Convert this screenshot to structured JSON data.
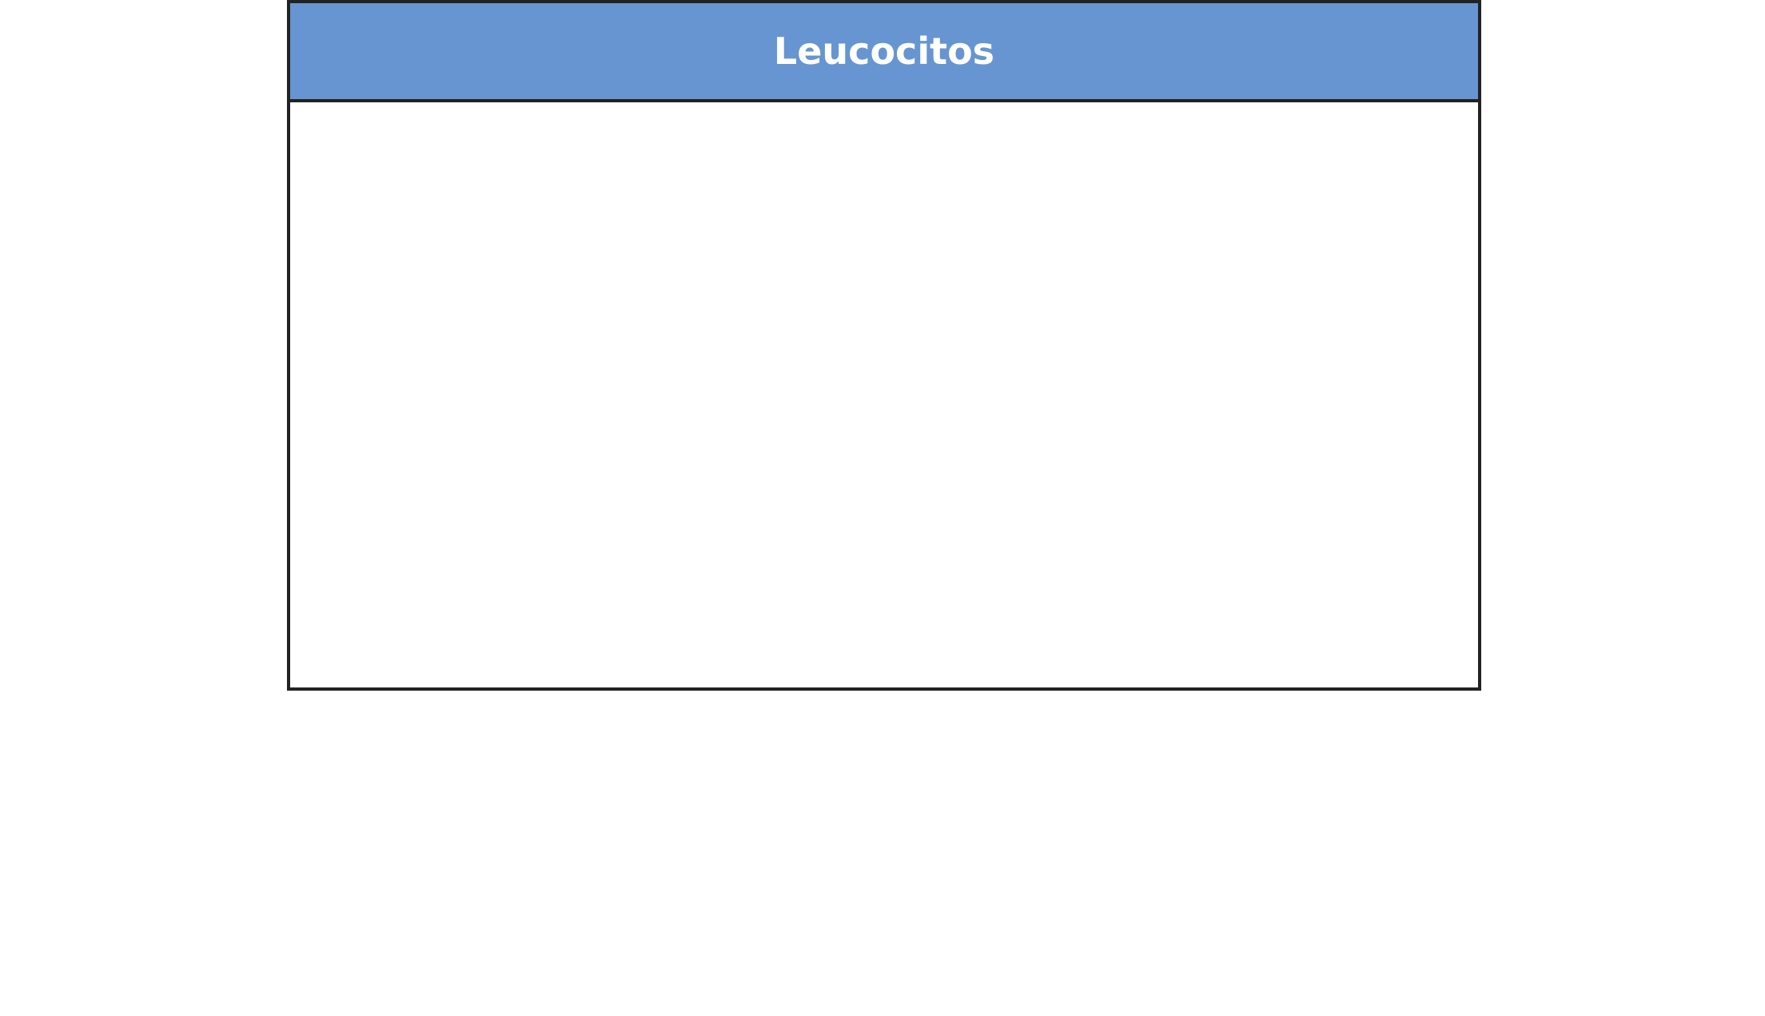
{
  "panel": {
    "title": "Leucocitos",
    "header_color": "#6795d1",
    "border_color": "#222222"
  }
}
